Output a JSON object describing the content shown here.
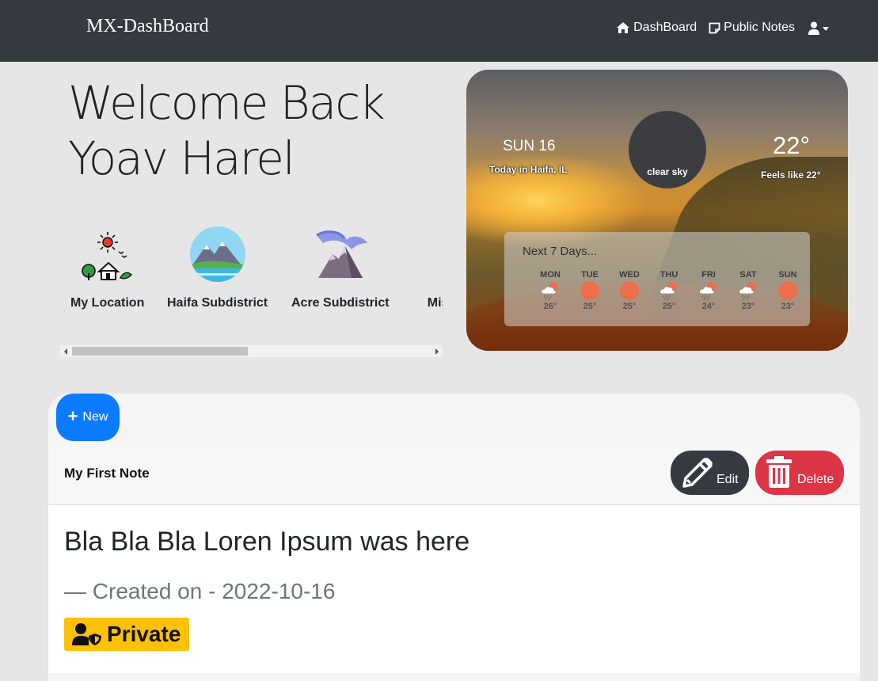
{
  "navbar": {
    "brand": "MX-DashBoard",
    "links": [
      {
        "label": "DashBoard",
        "icon": "home-icon"
      },
      {
        "label": "Public Notes",
        "icon": "note-icon"
      }
    ],
    "user_icon": "user-icon"
  },
  "welcome": {
    "line1": "Welcome Back",
    "line2": "Yoav Harel"
  },
  "locations": [
    {
      "label": "My Location",
      "icon": "house-sun-icon"
    },
    {
      "label": "Haifa Subdistrict",
      "icon": "mountain-lake-icon"
    },
    {
      "label": "Acre Subdistrict",
      "icon": "mountain-peak-icon"
    },
    {
      "label": "Misg",
      "icon": "truncated-location-icon"
    }
  ],
  "weather": {
    "day": "SUN 16",
    "location": "Today in Haifa, IL",
    "description": "clear sky",
    "temp": "22°",
    "feels_like": "Feels like 22°",
    "forecast_title": "Next 7 Days...",
    "forecast": [
      {
        "day": "MON",
        "temp": "26°",
        "icon": "rain-cloud-icon"
      },
      {
        "day": "TUE",
        "temp": "25°",
        "icon": "sun-icon"
      },
      {
        "day": "WED",
        "temp": "25°",
        "icon": "sun-icon"
      },
      {
        "day": "THU",
        "temp": "25°",
        "icon": "rain-cloud-icon"
      },
      {
        "day": "FRI",
        "temp": "24°",
        "icon": "rain-cloud-icon"
      },
      {
        "day": "SAT",
        "temp": "23°",
        "icon": "rain-cloud-icon"
      },
      {
        "day": "SUN",
        "temp": "23°",
        "icon": "sun-icon"
      }
    ]
  },
  "notes": {
    "new_label": "New",
    "note": {
      "title": "My First Note",
      "edit_label": "Edit",
      "delete_label": "Delete",
      "body": "Bla Bla Bla Loren Ipsum was here",
      "created": "— Created on - 2022-10-16",
      "badge": "Private"
    }
  },
  "colors": {
    "navbar": "#343a40",
    "primary": "#0d7bff",
    "danger": "#dc3545",
    "warning": "#ffc107",
    "forecast_sun": "#ec6e4c"
  }
}
